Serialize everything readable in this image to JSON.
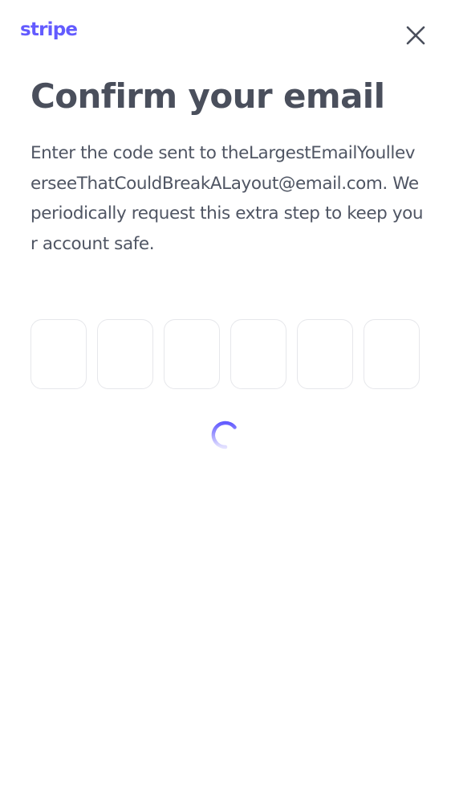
{
  "header": {
    "logo_text": "stripe",
    "close_icon": "close-icon"
  },
  "main": {
    "title": "Confirm your email",
    "description": "Enter the code sent to theLargestEmailYoulleverseeThatCouldBreakALayout@email.com. We periodically request this extra step to keep your account safe.",
    "code_length": 6,
    "code_values": [
      "",
      "",
      "",
      "",
      "",
      ""
    ],
    "loading_icon": "spinner-icon"
  },
  "colors": {
    "brand": "#635bff",
    "text": "#4a4f5c",
    "input_border": "#e6e7eb",
    "spinner_start": "#635bff",
    "spinner_end": "#e3e1ff"
  }
}
